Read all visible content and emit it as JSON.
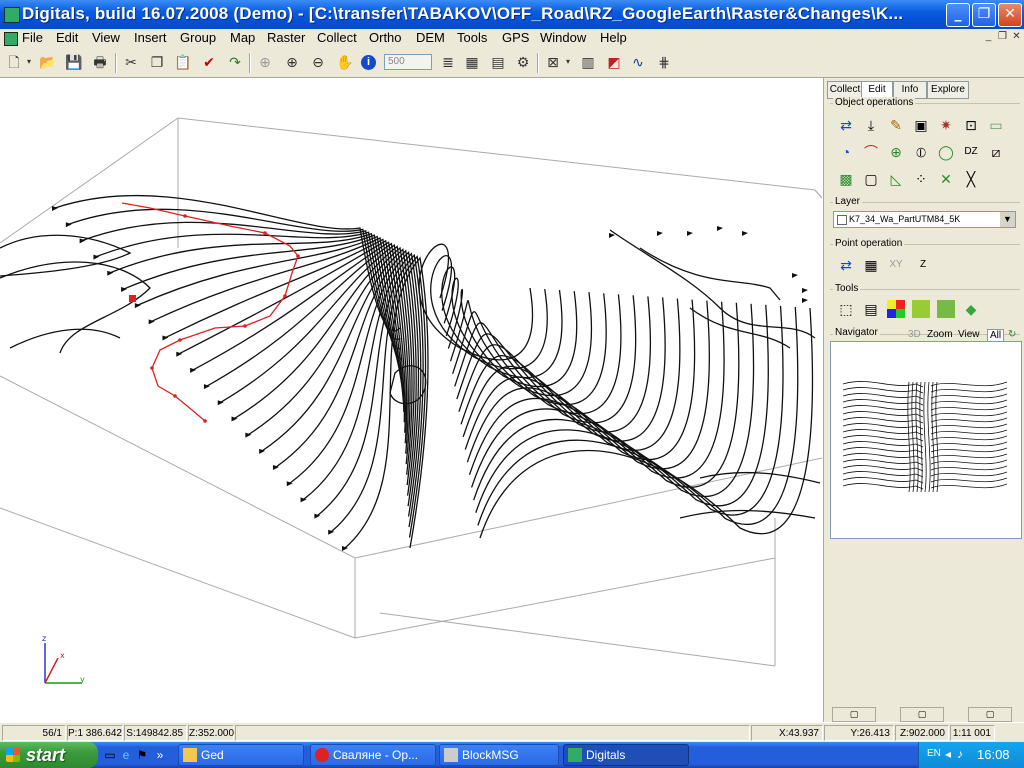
{
  "window": {
    "title": "Digitals, build 16.07.2008 (Demo) - [C:\\transfer\\TABAKOV\\OFF_Road\\RZ_GoogleEarth\\Raster&Changes\\K..."
  },
  "menu": [
    "File",
    "Edit",
    "View",
    "Insert",
    "Group",
    "Map",
    "Raster",
    "Collect",
    "Ortho",
    "DEM",
    "Tools",
    "GPS",
    "Window",
    "Help"
  ],
  "toolbar": {
    "zoom_value": "500",
    "icons": [
      "new-file-icon",
      "open-folder-icon",
      "save-icon",
      "print-icon",
      "cut-icon",
      "copy-icon",
      "paste-icon",
      "check-icon",
      "redo-icon",
      "pan-icon",
      "zoom-in-icon",
      "zoom-out-icon",
      "hand-icon",
      "info-icon"
    ]
  },
  "panel": {
    "tabs": [
      "Collect",
      "Edit",
      "Info",
      "Explore"
    ],
    "active_tab": "Edit",
    "object_operations_label": "Object operations",
    "layer_label": "Layer",
    "layer_value": "K7_34_Wa_PartUTM84_5K",
    "point_operation_label": "Point operation",
    "xy_label": "XY",
    "z_label": "Z",
    "tools_label": "Tools",
    "navigator_label": "Navigator",
    "navigator_tabs": [
      "3D",
      "Zoom",
      "View",
      "All"
    ]
  },
  "status": {
    "index": "56/1",
    "p": "P:1 386.642",
    "s": "S:149842.85",
    "z": "Z:352.000",
    "x": "X:43.937",
    "y": "Y:26.413",
    "z2": "Z:902.000",
    "scale": "1:11 001"
  },
  "taskbar": {
    "start_label": "start",
    "tasks": [
      "Ged",
      "Сваляне - Ор...",
      "BlockMSG",
      "Digitals"
    ],
    "active_task": "Digitals",
    "lang": "EN",
    "time": "16:08"
  }
}
